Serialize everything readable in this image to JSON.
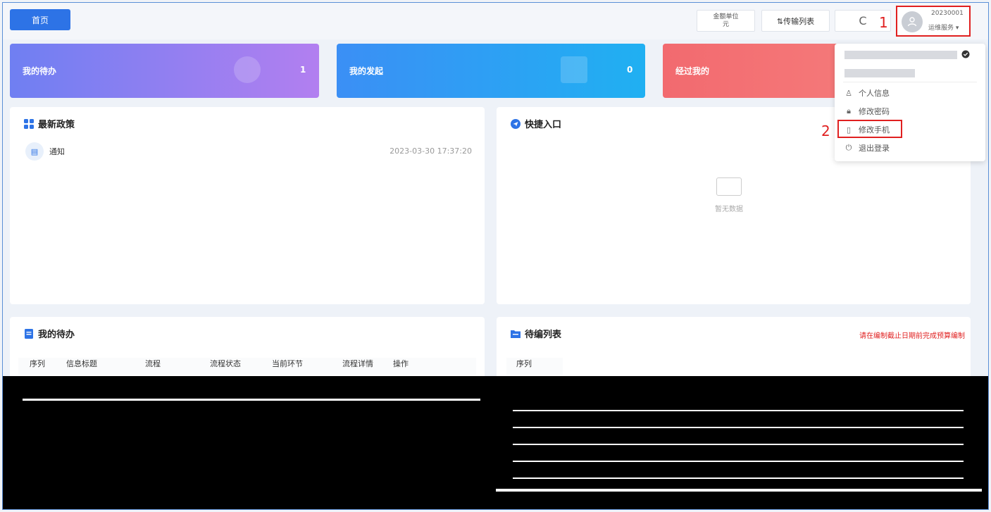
{
  "topbar": {
    "home": "首页",
    "unit_line1": "金额单位",
    "unit_line2": "元",
    "transfer": "⇅传输列表",
    "refresh_icon": "C",
    "user_id": "20230001",
    "user_role": "运维服务 ▾"
  },
  "callouts": {
    "one": "1",
    "two": "2"
  },
  "stats": [
    {
      "label": "我的待办",
      "count": "1"
    },
    {
      "label": "我的发起",
      "count": "0"
    },
    {
      "label": "经过我的",
      "count": ""
    }
  ],
  "policy": {
    "title": "最新政策",
    "notice_label": "通知",
    "notice_time": "2023-03-30 17:37:20"
  },
  "quick": {
    "title": "快捷入口",
    "empty": "暂无数据"
  },
  "todo": {
    "title": "我的待办",
    "columns": [
      "序列",
      "信息标题",
      "流程",
      "流程状态",
      "当前环节",
      "流程详情",
      "操作"
    ]
  },
  "edit": {
    "title": "待编列表",
    "warning": "请在编制截止日期前完成预算编制",
    "first_column": "序列"
  },
  "dropdown": {
    "items": [
      "个人信息",
      "修改密码",
      "修改手机",
      "退出登录"
    ]
  },
  "colors": {
    "primary": "#2d73e6",
    "highlight": "#e02020"
  }
}
